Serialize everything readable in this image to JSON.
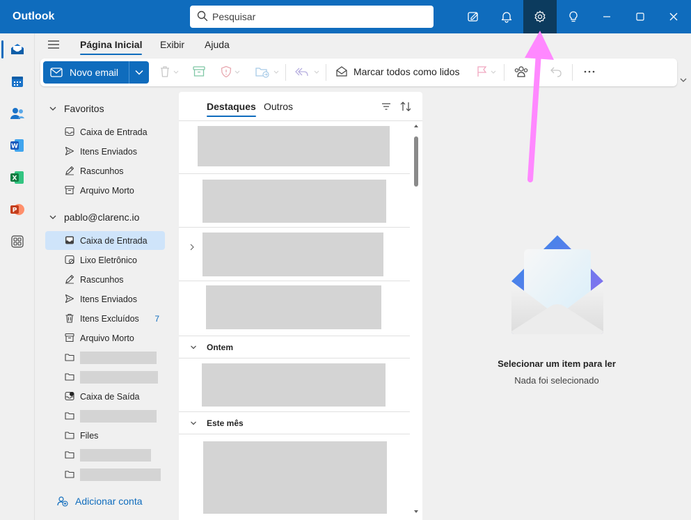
{
  "app": {
    "title": "Outlook"
  },
  "search": {
    "placeholder": "Pesquisar"
  },
  "menu": {
    "tabs": [
      "Página Inicial",
      "Exibir",
      "Ajuda"
    ]
  },
  "ribbon": {
    "new_mail": "Novo email",
    "mark_all_read": "Marcar todos como lidos"
  },
  "folders": {
    "favorites_header": "Favoritos",
    "favorites": [
      "Caixa de Entrada",
      "Itens Enviados",
      "Rascunhos",
      "Arquivo Morto"
    ],
    "account_header": "pablo@clarenc.io",
    "account_items": [
      {
        "label": "Caixa de Entrada"
      },
      {
        "label": "Lixo Eletrônico"
      },
      {
        "label": "Rascunhos"
      },
      {
        "label": "Itens Enviados"
      },
      {
        "label": "Itens Excluídos",
        "count": "7"
      },
      {
        "label": "Arquivo Morto"
      },
      {
        "label": ""
      },
      {
        "label": ""
      },
      {
        "label": "Caixa de Saída"
      },
      {
        "label": ""
      },
      {
        "label": "Files"
      },
      {
        "label": ""
      },
      {
        "label": ""
      }
    ],
    "add_account": "Adicionar conta"
  },
  "message_list": {
    "tabs": [
      "Destaques",
      "Outros"
    ],
    "groups": [
      "Ontem",
      "Este mês"
    ]
  },
  "reading_pane": {
    "title": "Selecionar um item para ler",
    "subtitle": "Nada foi selecionado"
  },
  "colors": {
    "accent": "#0f6cbd",
    "selected_folder": "#cfe4fa",
    "annotation_arrow": "#ff88ff"
  }
}
